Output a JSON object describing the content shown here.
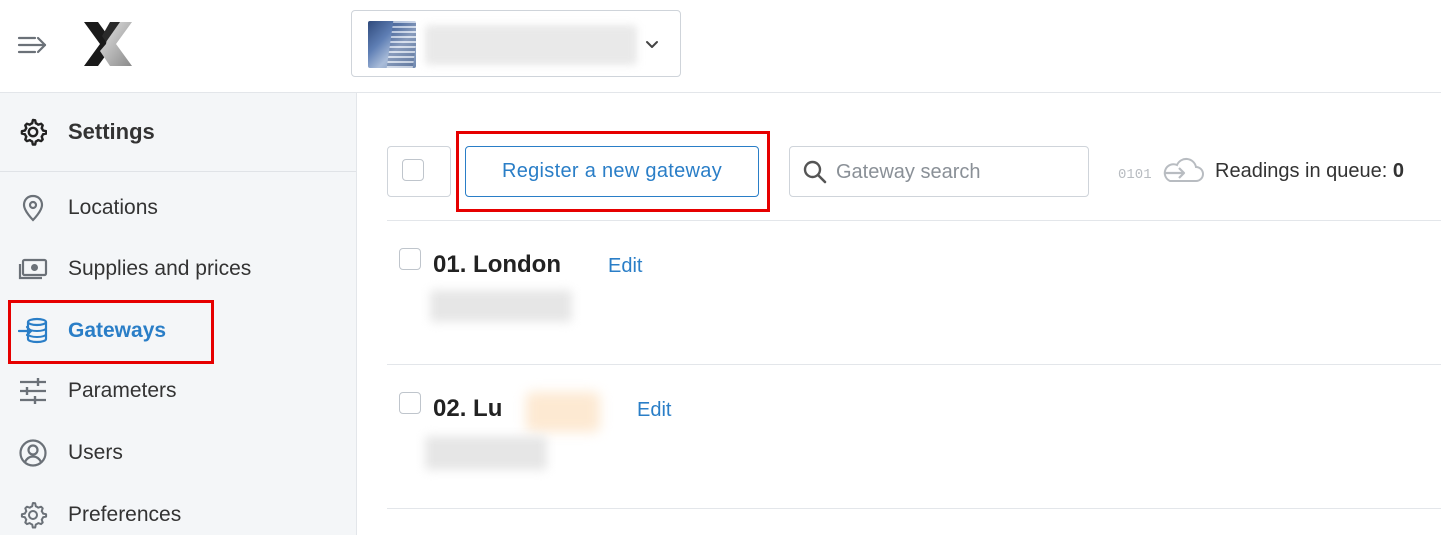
{
  "topbar": {
    "account_selector": {
      "name": ""
    }
  },
  "sidebar": {
    "header": {
      "label": "Settings",
      "icon": "gear-icon"
    },
    "items": [
      {
        "label": "Locations",
        "icon": "location-pin-icon",
        "active": false
      },
      {
        "label": "Supplies and prices",
        "icon": "money-icon",
        "active": false
      },
      {
        "label": "Gateways",
        "icon": "gateway-icon",
        "active": true
      },
      {
        "label": "Parameters",
        "icon": "sliders-icon",
        "active": false
      },
      {
        "label": "Users",
        "icon": "user-circle-icon",
        "active": false
      },
      {
        "label": "Preferences",
        "icon": "gear-icon",
        "active": false
      }
    ]
  },
  "toolbar": {
    "register_label": "Register a new gateway",
    "search_placeholder": "Gateway search",
    "search_value": "",
    "queue_icon_prefix": "0101",
    "queue_label": "Readings in queue:",
    "queue_count": "0"
  },
  "gateways": [
    {
      "title": "01. London",
      "edit_label": "Edit"
    },
    {
      "title": "02. Lu",
      "edit_label": "Edit"
    }
  ],
  "colors": {
    "accent": "#2a7ec7",
    "highlight": "#e60000",
    "sidebar_bg": "#f4f6f8"
  }
}
